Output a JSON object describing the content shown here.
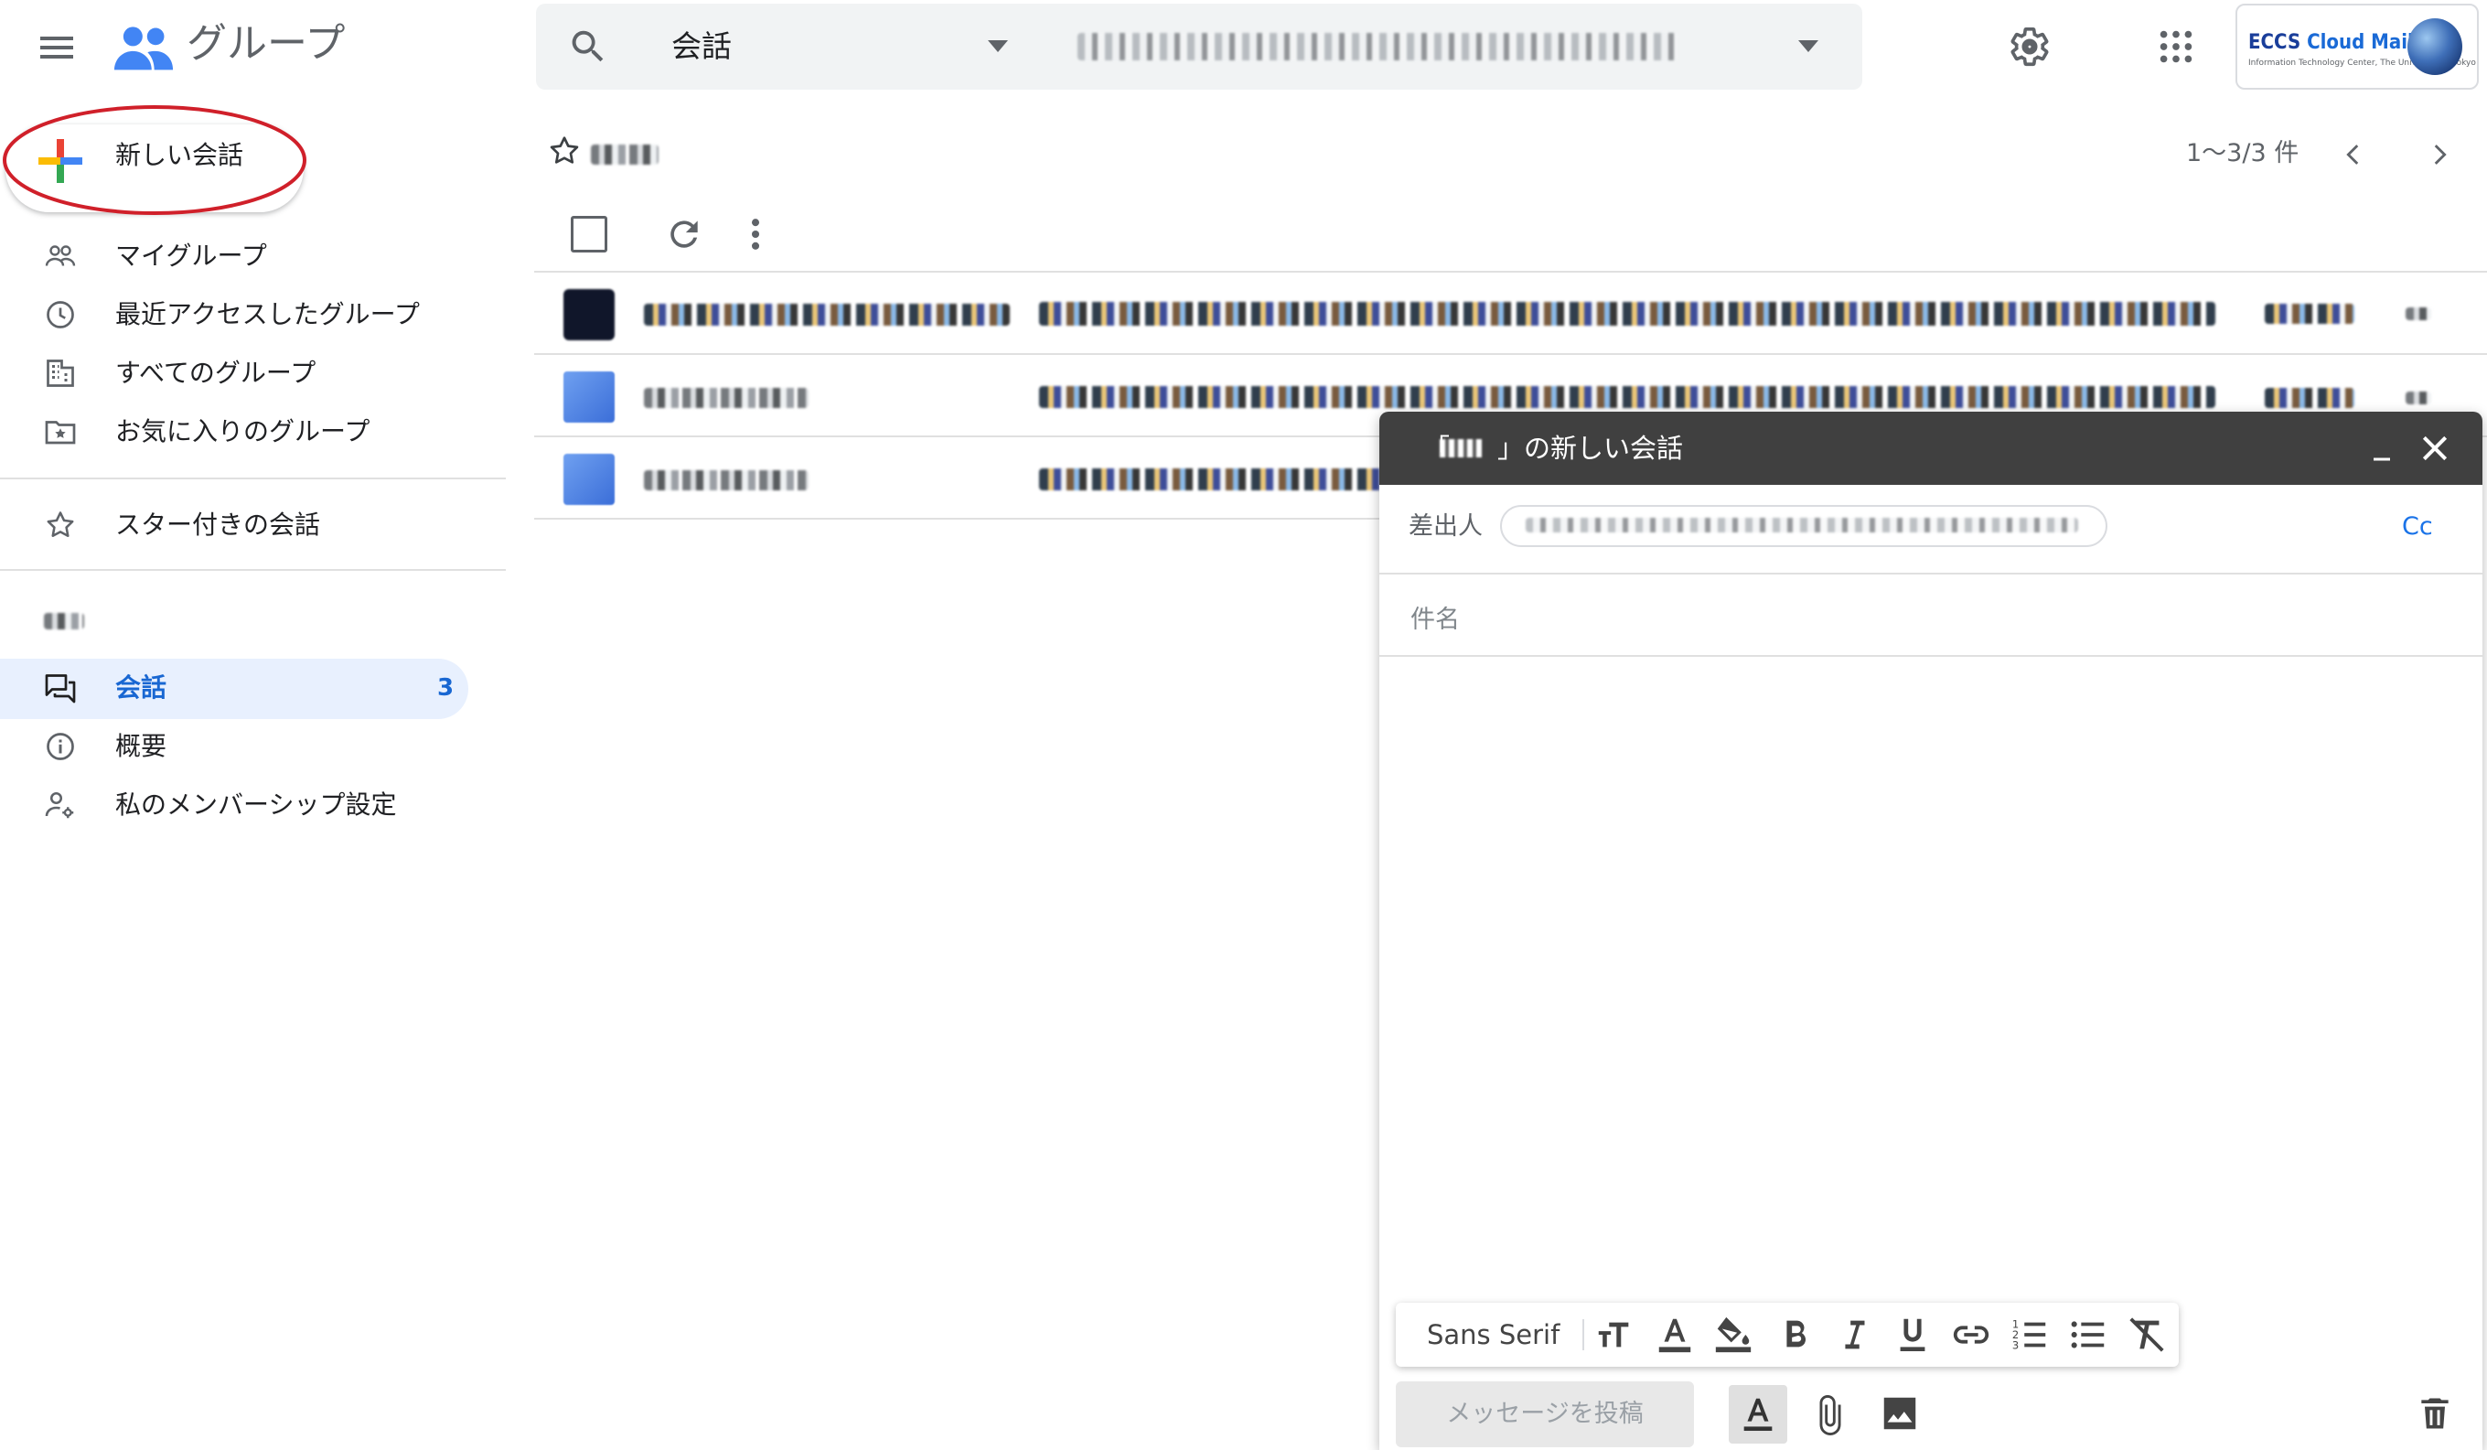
{
  "header": {
    "menu_icon": "hamburger-menu-icon",
    "app_title": "グループ",
    "search": {
      "scope_label": "会話"
    },
    "org_logo": {
      "name_a": "ECCS",
      "name_b": " Cloud Mail",
      "subtitle": "Information Technology Center, The University of Tokyo"
    }
  },
  "sidebar": {
    "new_conversation_label": "新しい会話",
    "nav_primary": [
      {
        "label": "マイグループ",
        "icon": "people-outline-icon"
      },
      {
        "label": "最近アクセスしたグループ",
        "icon": "clock-icon"
      },
      {
        "label": "すべてのグループ",
        "icon": "building-icon"
      },
      {
        "label": "お気に入りのグループ",
        "icon": "starred-folder-icon"
      }
    ],
    "starred_label": "スター付きの会話",
    "group_nav": [
      {
        "label": "会話",
        "icon": "forum-icon",
        "count": "3",
        "active": true
      },
      {
        "label": "概要",
        "icon": "info-icon"
      },
      {
        "label": "私のメンバーシップ設定",
        "icon": "person-settings-icon"
      }
    ]
  },
  "main": {
    "pagination": "1〜3/3 件",
    "conversation_count": 3
  },
  "compose": {
    "title_suffix": "」の新しい会話",
    "title_prefix": "「",
    "from_label": "差出人",
    "cc_label": "Cc",
    "subject_placeholder": "件名",
    "font_name": "Sans Serif",
    "send_label": "メッセージを投稿"
  },
  "colors": {
    "accent_blue": "#1a73e8",
    "active_nav_bg": "#e8f0fe",
    "compose_header": "#404040",
    "annotation_red": "#d0202a"
  }
}
